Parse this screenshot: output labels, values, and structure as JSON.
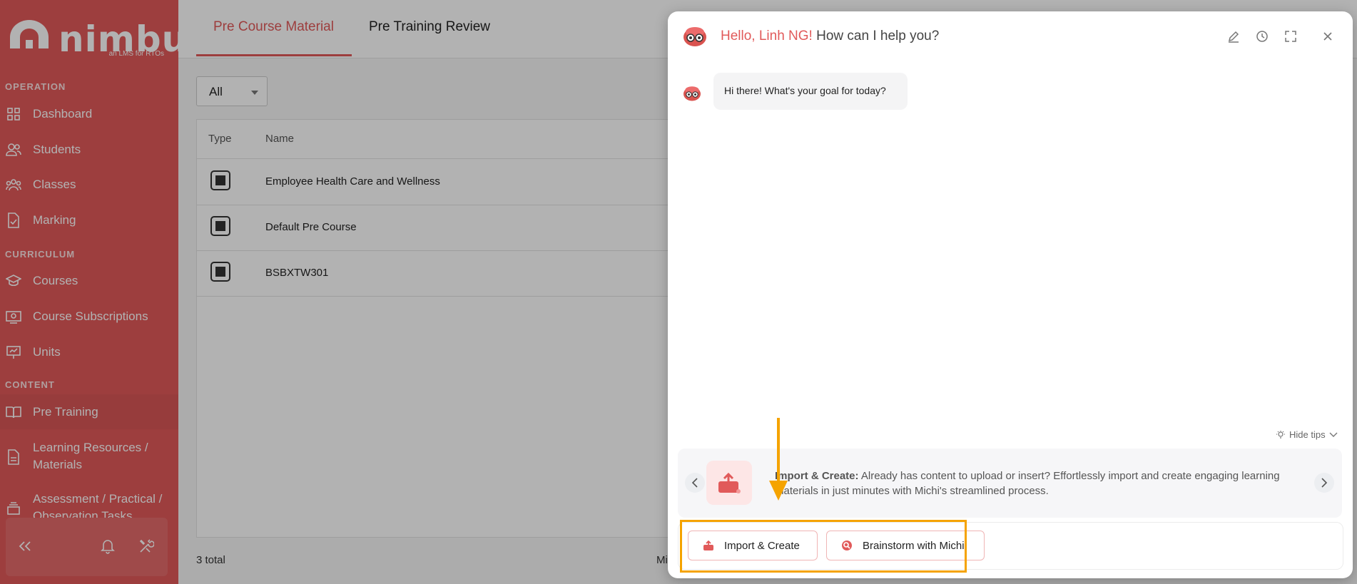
{
  "sidebar": {
    "logo_text": "nimbu",
    "logo_sub": "an LMS for RTOs",
    "sections": {
      "operation": "OPERATION",
      "curriculum": "CURRICULUM",
      "content": "CONTENT"
    },
    "items": [
      {
        "label": "Dashboard",
        "icon": "grid-icon"
      },
      {
        "label": "Students",
        "icon": "users-icon"
      },
      {
        "label": "Classes",
        "icon": "group-icon"
      },
      {
        "label": "Marking",
        "icon": "document-check-icon"
      },
      {
        "label": "Courses",
        "icon": "graduation-cap-icon"
      },
      {
        "label": "Course Subscriptions",
        "icon": "subscription-icon"
      },
      {
        "label": "Units",
        "icon": "presentation-icon"
      },
      {
        "label": "Pre Training",
        "icon": "book-open-icon",
        "active": true
      },
      {
        "label": "Learning Resources / Materials",
        "icon": "file-icon"
      },
      {
        "label": "Assessment / Practical / Observation Tasks",
        "icon": "layers-icon"
      }
    ]
  },
  "main": {
    "tabs": [
      {
        "label": "Pre Course Material",
        "active": true
      },
      {
        "label": "Pre Training Review"
      }
    ],
    "filter": {
      "value": "All"
    },
    "table": {
      "columns": [
        "Type",
        "Name"
      ],
      "rows": [
        {
          "name": "Employee Health Care and Wellness"
        },
        {
          "name": "Default Pre Course"
        },
        {
          "name": "BSBXTW301"
        }
      ]
    },
    "total": "3 total",
    "truncated": "Mi"
  },
  "chat": {
    "greeting_hi": "Hello, Linh NG!",
    "greeting_rest": " How can I help you?",
    "bot_message": "Hi there! What's your goal for today?",
    "hide_tips": "Hide tips",
    "tip": {
      "title": "Import & Create:",
      "body": " Already has content to upload or insert? Effortlessly import and create engaging learning materials in just minutes with Michi's streamlined process."
    },
    "actions": [
      {
        "label": "Import & Create"
      },
      {
        "label": "Brainstorm with Michi"
      }
    ],
    "colors": {
      "accent": "#e15a5a",
      "highlight": "#f5a300"
    }
  }
}
